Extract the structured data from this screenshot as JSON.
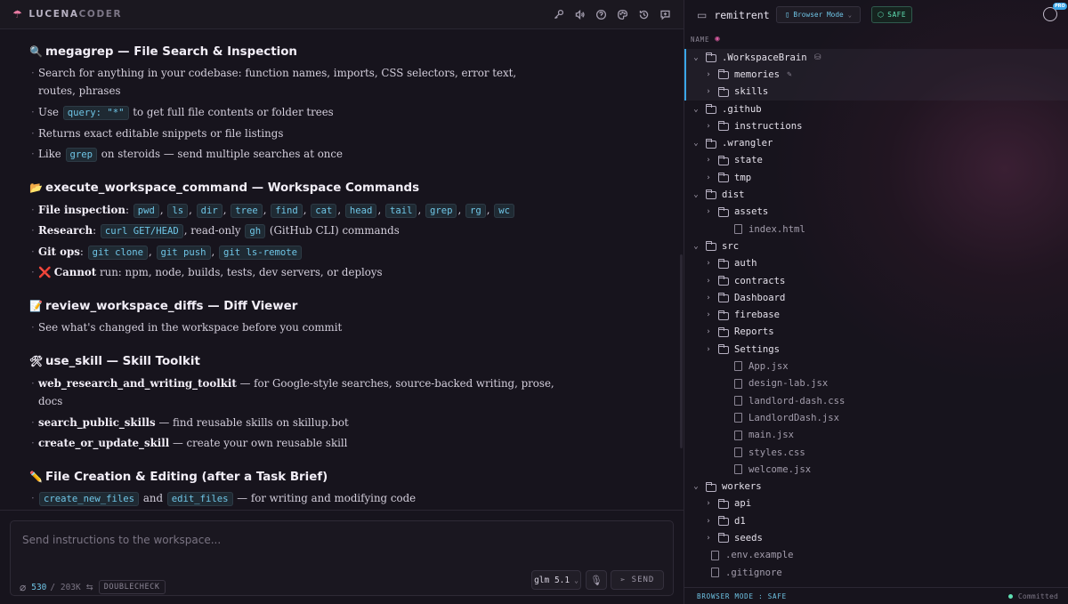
{
  "app": {
    "logo_prefix": "LUCENA",
    "logo_suffix": "CODER"
  },
  "toolbar_icons": [
    "key-icon",
    "volume-icon",
    "help-icon",
    "palette-icon",
    "history-icon",
    "chat-icon"
  ],
  "docs": {
    "s1": {
      "emoji": "🔍",
      "title": "megagrep — File Search & Inspection",
      "i1a": "Search for anything in your codebase: function names, imports, CSS selectors, error text,",
      "i1b": "routes, phrases",
      "i2_pre": "Use",
      "i2_code": "query: \"*\"",
      "i2_post": "to get full file contents or folder trees",
      "i3": "Returns exact editable snippets or file listings",
      "i4_pre": "Like",
      "i4_code": "grep",
      "i4_post": "on steroids — send multiple searches at once"
    },
    "s2": {
      "emoji": "📂",
      "title": "execute_workspace_command — Workspace Commands",
      "i1_label": "File inspection",
      "i1_cmds": [
        "pwd",
        "ls",
        "dir",
        "tree",
        "find",
        "cat",
        "head",
        "tail",
        "grep",
        "rg",
        "wc"
      ],
      "i2_label": "Research",
      "i2_code1": "curl GET/HEAD",
      "i2_mid": ", read-only",
      "i2_code2": "gh",
      "i2_post": "(GitHub CLI) commands",
      "i3_label": "Git ops",
      "i3_cmds": [
        "git clone",
        "git push",
        "git ls-remote"
      ],
      "i4_x": "❌",
      "i4_label": "Cannot",
      "i4_post": "run: npm, node, builds, tests, dev servers, or deploys"
    },
    "s3": {
      "emoji": "📝",
      "title": "review_workspace_diffs — Diff Viewer",
      "i1": "See what's changed in the workspace before you commit"
    },
    "s4": {
      "emoji": "🛠",
      "title": "use_skill — Skill Toolkit",
      "i1_label": "web_research_and_writing_toolkit",
      "i1_post": "— for Google-style searches, source-backed writing, prose,",
      "i1b": "docs",
      "i2_label": "search_public_skills",
      "i2_post": "— find reusable skills on skillup.bot",
      "i3_label": "create_or_update_skill",
      "i3_post": "— create your own reusable skill"
    },
    "s5": {
      "emoji": "✏️",
      "title": "File Creation & Editing (after a Task Brief)",
      "i1_code1": "create_new_files",
      "i1_mid": "and",
      "i1_code2": "edit_files",
      "i1_post": "— for writing and modifying code"
    }
  },
  "composer": {
    "placeholder": "Send instructions to the workspace...",
    "tokens_used": "530",
    "tokens_max": "/ 203K",
    "badge": "DOUBLECHECK",
    "model": "glm 5.1",
    "send_label": "SEND"
  },
  "explorer": {
    "project": "remitrent",
    "browser_mode": "Browser Mode",
    "safe_label": "SAFE",
    "pro_badge": "PRO",
    "name_header": "NAME",
    "tree": [
      {
        "label": ".WorkspaceBrain",
        "type": "folder",
        "open": true,
        "depth": 0,
        "extra": "db-icon"
      },
      {
        "label": "memories",
        "type": "folder",
        "open": false,
        "depth": 1,
        "extra": "edit-icon"
      },
      {
        "label": "skills",
        "type": "folder",
        "open": false,
        "depth": 1
      },
      {
        "label": ".github",
        "type": "folder",
        "open": true,
        "depth": 0
      },
      {
        "label": "instructions",
        "type": "folder",
        "open": false,
        "depth": 1
      },
      {
        "label": ".wrangler",
        "type": "folder",
        "open": true,
        "depth": 0
      },
      {
        "label": "state",
        "type": "folder",
        "open": false,
        "depth": 1
      },
      {
        "label": "tmp",
        "type": "folder",
        "open": false,
        "depth": 1
      },
      {
        "label": "dist",
        "type": "folder",
        "open": true,
        "depth": 0
      },
      {
        "label": "assets",
        "type": "folder",
        "open": false,
        "depth": 1
      },
      {
        "label": "index.html",
        "type": "file",
        "depth": 1
      },
      {
        "label": "src",
        "type": "folder",
        "open": true,
        "depth": 0
      },
      {
        "label": "auth",
        "type": "folder",
        "open": false,
        "depth": 1
      },
      {
        "label": "contracts",
        "type": "folder",
        "open": false,
        "depth": 1
      },
      {
        "label": "Dashboard",
        "type": "folder",
        "open": false,
        "depth": 1
      },
      {
        "label": "firebase",
        "type": "folder",
        "open": false,
        "depth": 1
      },
      {
        "label": "Reports",
        "type": "folder",
        "open": false,
        "depth": 1
      },
      {
        "label": "Settings",
        "type": "folder",
        "open": false,
        "depth": 1
      },
      {
        "label": "App.jsx",
        "type": "file",
        "depth": 1
      },
      {
        "label": "design-lab.jsx",
        "type": "file",
        "depth": 1
      },
      {
        "label": "landlord-dash.css",
        "type": "file",
        "depth": 1
      },
      {
        "label": "LandlordDash.jsx",
        "type": "file",
        "depth": 1
      },
      {
        "label": "main.jsx",
        "type": "file",
        "depth": 1
      },
      {
        "label": "styles.css",
        "type": "file",
        "depth": 1
      },
      {
        "label": "welcome.jsx",
        "type": "file",
        "depth": 1
      },
      {
        "label": "workers",
        "type": "folder",
        "open": true,
        "depth": 0
      },
      {
        "label": "api",
        "type": "folder",
        "open": false,
        "depth": 1
      },
      {
        "label": "d1",
        "type": "folder",
        "open": false,
        "depth": 1
      },
      {
        "label": "seeds",
        "type": "folder",
        "open": false,
        "depth": 1
      },
      {
        "label": ".env.example",
        "type": "file",
        "depth": 0
      },
      {
        "label": ".gitignore",
        "type": "file",
        "depth": 0
      }
    ],
    "status_mode": "BROWSER MODE : SAFE",
    "status_commit": "Committed"
  }
}
